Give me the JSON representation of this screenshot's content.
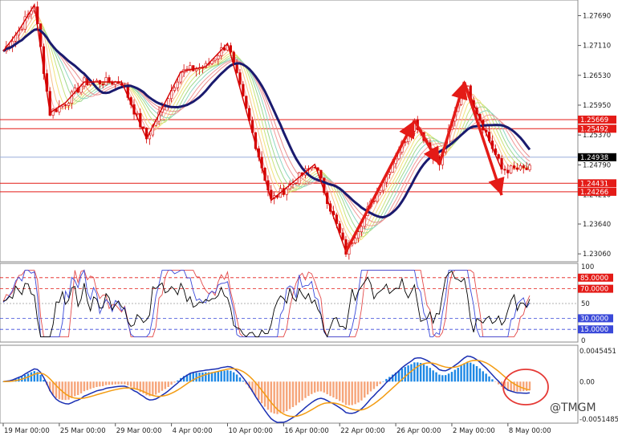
{
  "chart_data": {
    "type": "candlestick",
    "instrument_hint": "",
    "watermark": "@TMGM",
    "colors": {
      "candle": "#d40000",
      "ma_main": "#1a1a6e",
      "hline_red": "#e41b17",
      "hline_blue": "#9aaed9",
      "arrow": "#e41b17",
      "rsi_fast": "#000000",
      "rsi_mid": "#3a49d9",
      "rsi_slow": "#e34b4b",
      "macd_pos": "#1e88e5",
      "macd_neg": "#f6a57a",
      "macd_line": "#1a2fb3",
      "signal_line": "#f39c12",
      "circle": "#e53935"
    },
    "price_panel": {
      "ylim": [
        1.23,
        1.279
      ],
      "y_ticks": [
        "1.27690",
        "1.27110",
        "1.26530",
        "1.25950",
        "1.25370",
        "1.24790",
        "1.24210",
        "1.23640",
        "1.23060"
      ],
      "levels_red": [
        {
          "value": 1.25669,
          "label": "1.25669"
        },
        {
          "value": 1.25492,
          "label": "1.25492"
        },
        {
          "value": 1.24431,
          "label": "1.24431"
        },
        {
          "value": 1.24266,
          "label": "1.24266"
        }
      ],
      "level_blue": {
        "value": 1.24938,
        "label": "1.24938"
      },
      "zigzag": [
        [
          0,
          1.27
        ],
        [
          5,
          1.274
        ],
        [
          10,
          1.279
        ],
        [
          15,
          1.258
        ],
        [
          20,
          1.26
        ],
        [
          26,
          1.264
        ],
        [
          38,
          1.264
        ],
        [
          46,
          1.253
        ],
        [
          57,
          1.266
        ],
        [
          65,
          1.267
        ],
        [
          72,
          1.2715
        ],
        [
          86,
          1.241
        ],
        [
          100,
          1.248
        ],
        [
          110,
          1.231
        ],
        [
          132,
          1.2565
        ],
        [
          140,
          1.248
        ],
        [
          148,
          1.264
        ],
        [
          160,
          1.247
        ]
      ],
      "arrows": [
        [
          110,
          1.231,
          132,
          1.2565
        ],
        [
          132,
          1.2565,
          140,
          1.248
        ],
        [
          140,
          1.248,
          148,
          1.264
        ],
        [
          148,
          1.264,
          160,
          1.242
        ]
      ]
    },
    "rsi_panel": {
      "ylim": [
        0,
        100
      ],
      "y_ticks": [
        "100",
        "50",
        "0"
      ],
      "levels": [
        {
          "value": 85,
          "label": "85.0000",
          "color": "#e41b17"
        },
        {
          "value": 70,
          "label": "70.0000",
          "color": "#e41b17"
        },
        {
          "value": 30,
          "label": "30.0000",
          "color": "#3a49d9"
        },
        {
          "value": 15,
          "label": "15.0000",
          "color": "#3a49d9"
        }
      ]
    },
    "macd_panel": {
      "ylim": [
        -0.0051485,
        0.0045451
      ],
      "y_ticks": [
        "0.0045451",
        "0.00",
        "-0.0051485"
      ]
    },
    "x_ticks": [
      "19 Mar 00:00",
      "25 Mar 00:00",
      "29 Mar 00:00",
      "4 Apr 00:00",
      "10 Apr 00:00",
      "16 Apr 00:00",
      "22 Apr 00:00",
      "26 Apr 00:00",
      "2 May 00:00",
      "8 May 00:00"
    ],
    "x_tick_index": [
      0,
      18,
      36,
      54,
      72,
      90,
      108,
      126,
      144,
      162
    ]
  }
}
